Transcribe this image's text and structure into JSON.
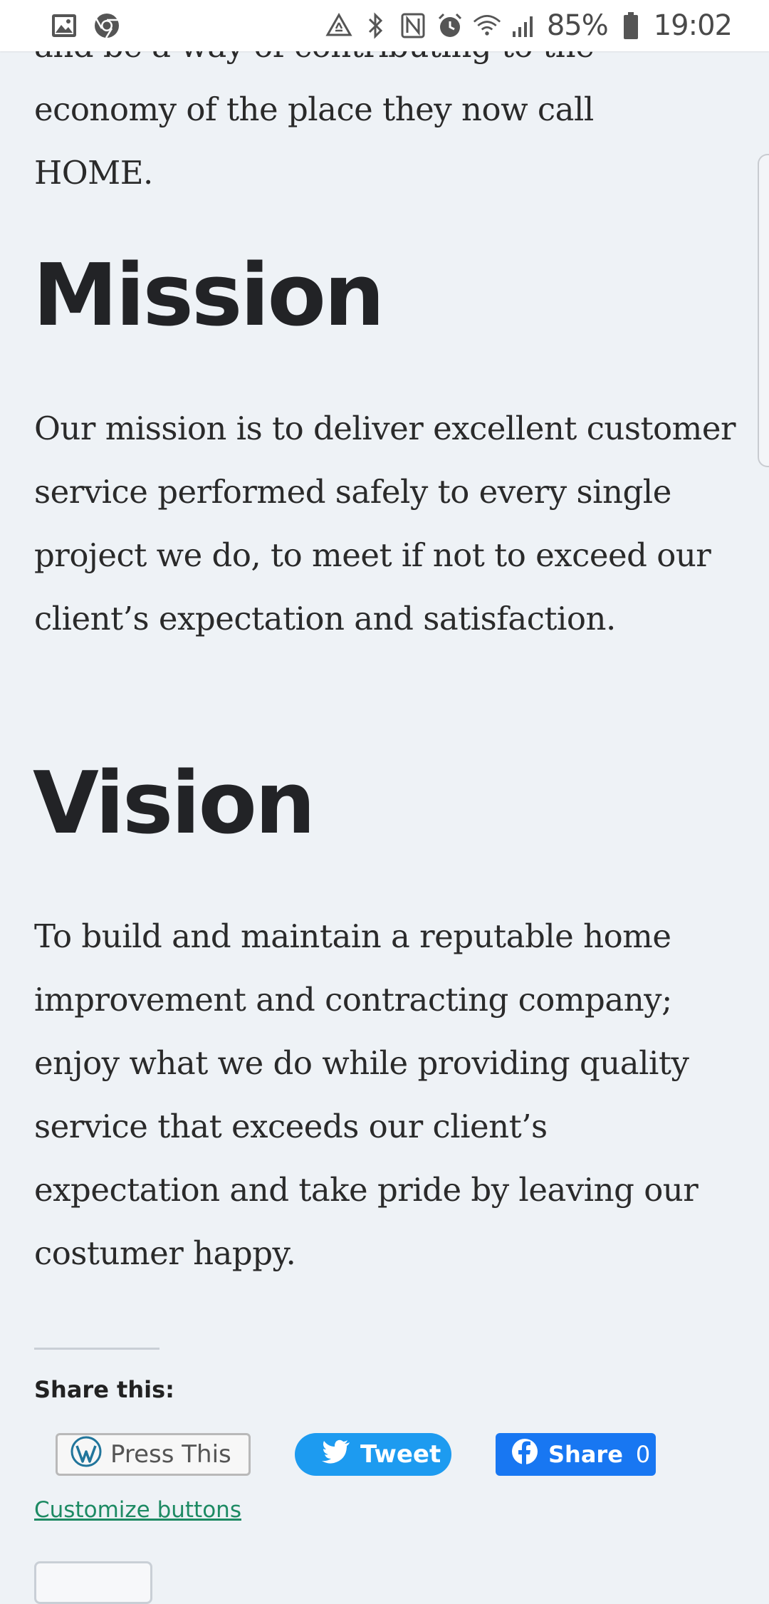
{
  "status_bar": {
    "battery_percent": "85%",
    "time": "19:02",
    "icons_left": [
      "gallery-icon",
      "chrome-icon"
    ],
    "icons_right": [
      "recycle-icon",
      "bluetooth-icon",
      "nfc-icon",
      "alarm-icon",
      "wifi-icon",
      "signal-icon",
      "battery-icon"
    ]
  },
  "article": {
    "intro_line1": "and be a way of contributing to the",
    "intro_line2": "economy of the place they now call",
    "intro_line3": "HOME.",
    "mission_heading": "Mission",
    "mission_text": "Our mission is to deliver excellent customer service performed safely to every single project we do, to meet if not to exceed our client’s expectation and satisfaction.",
    "vision_heading": "Vision",
    "vision_text": "To build and maintain a reputable home improvement and contracting company; enjoy what we do while providing quality service that exceeds our client’s expectation and take pride by leaving our costumer happy."
  },
  "share": {
    "label": "Share this:",
    "press_this": "Press This",
    "tweet": "Tweet",
    "fb_share": "Share",
    "fb_count": "0",
    "customize": "Customize buttons"
  },
  "colors": {
    "background": "#eef2f6",
    "twitter": "#1d9bf0",
    "facebook": "#1877f2",
    "link": "#1d8a63"
  }
}
